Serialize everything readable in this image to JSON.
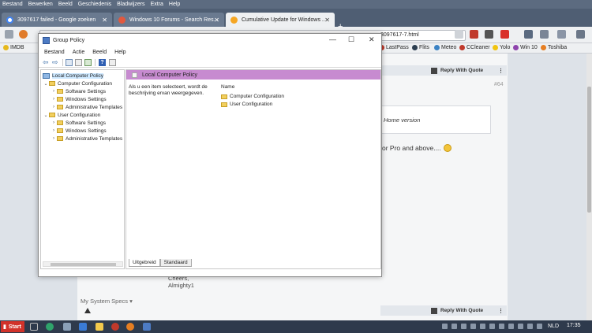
{
  "browser": {
    "menu": [
      "Bestand",
      "Bewerken",
      "Beeld",
      "Geschiedenis",
      "Bladwijzers",
      "Extra",
      "Help"
    ],
    "tabs": [
      {
        "title": "3097617 failed - Google zoeken",
        "active": false
      },
      {
        "title": "Windows 10 Forums - Search Res...",
        "active": false
      },
      {
        "title": "Cumulative Update for Windows ...",
        "active": true
      }
    ],
    "url_visible": "3097617-7.html",
    "bookmarks": [
      "IMDB",
      "LastPass",
      "Flits",
      "Meteo",
      "CCleaner",
      "Yolo",
      "Win 10",
      "Toshiba"
    ]
  },
  "forum": {
    "reply_label": "Reply With Quote",
    "post_number": "#64",
    "quote_text": "Home version",
    "post_text": "or Pro and above....",
    "signature": [
      "Cheers,",
      "Almighty1"
    ],
    "system_specs": "My System Specs"
  },
  "gpedit": {
    "title": "Group Policy",
    "menu": [
      "Bestand",
      "Actie",
      "Beeld",
      "Help"
    ],
    "tree": {
      "root": "Local Computer Policy",
      "computer": "Computer Configuration",
      "user": "User Configuration",
      "children": [
        "Software Settings",
        "Windows Settings",
        "Administrative Templates"
      ]
    },
    "detail": {
      "header": "Local Computer Policy",
      "description": "Als u een item selecteert, wordt de beschrijving ervan weergegeven.",
      "column_name": "Name",
      "items": [
        "Computer Configuration",
        "User Configuration"
      ],
      "tabs": [
        "Uitgebreid",
        "Standaard"
      ]
    }
  },
  "taskbar": {
    "start": "Start",
    "language": "NLD",
    "time": "17:35"
  },
  "colors": {
    "detail_header": "#c78bd0",
    "taskbar": "#2e3a4c",
    "start_button": "#d1322a"
  }
}
